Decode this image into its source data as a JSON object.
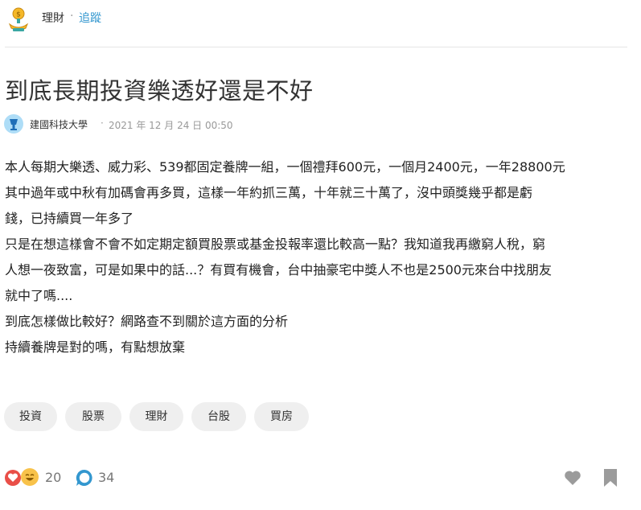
{
  "header": {
    "forum_name": "理財",
    "separator": "·",
    "follow_label": "追蹤"
  },
  "post": {
    "title": "到底長期投資樂透好還是不好",
    "author": "建國科技大學",
    "meta_separator": "·",
    "time": "2021 年 12 月 24 日 00:50",
    "content_lines": [
      "本人每期大樂透、威力彩、539都固定養牌一組，一個禮拜600元，一個月2400元，一年28800元",
      "其中過年或中秋有加碼會再多買，這樣一年約抓三萬，十年就三十萬了，沒中頭獎幾乎都是虧",
      "錢，已持續買一年多了",
      "只是在想這樣會不會不如定期定額買股票或基金投報率還比較高一點？我知道我再繳窮人稅，窮",
      "人想一夜致富，可是如果中的話...？有買有機會，台中抽豪宅中獎人不也是2500元來台中找朋友",
      "就中了嗎....",
      "到底怎樣做比較好？網路查不到關於這方面的分析",
      "持續養牌是對的嗎，有點想放棄"
    ]
  },
  "tags": [
    "投資",
    "股票",
    "理財",
    "台股",
    "買房"
  ],
  "footer": {
    "reaction_count": "20",
    "comment_count": "34"
  },
  "icons": {
    "forum": "trophy-coin-icon",
    "avatar": "school-avatar-icon",
    "reactions": [
      "heart-reaction-icon",
      "laugh-reaction-icon"
    ],
    "comment": "comment-bubble-icon",
    "like": "heart-icon",
    "bookmark": "bookmark-icon"
  },
  "colors": {
    "accent": "#3397cf",
    "heart": "#e94f48",
    "laugh": "#f8c24a",
    "icon_gray": "#9b9b9b",
    "tag_bg": "#efefef"
  }
}
